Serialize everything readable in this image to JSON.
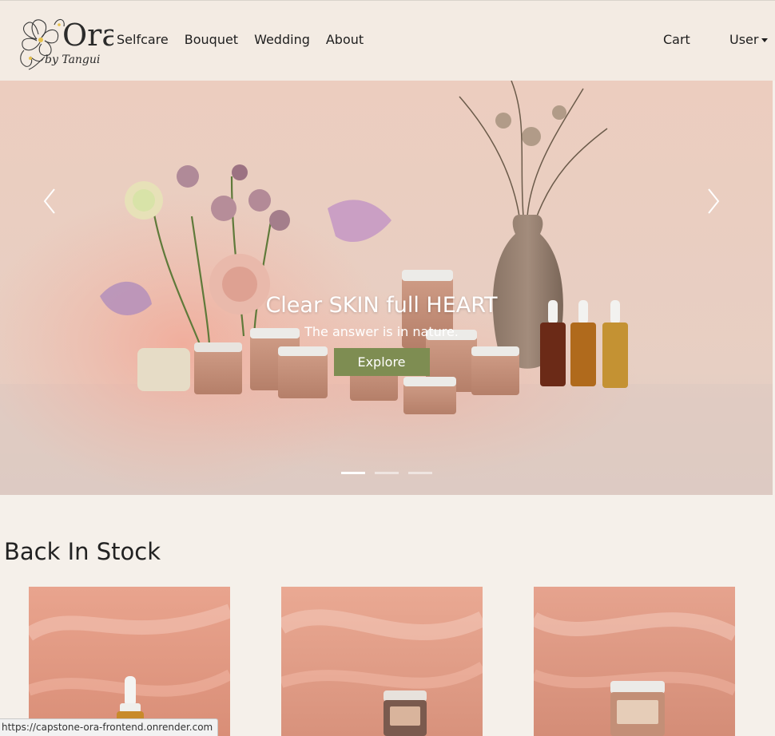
{
  "navbar": {
    "brand": {
      "name": "Ora",
      "tagline": "by Tangui"
    },
    "links": [
      "Selfcare",
      "Bouquet",
      "Wedding",
      "About"
    ],
    "cart_label": "Cart",
    "user_label": "User"
  },
  "hero": {
    "title": "Clear SKIN full HEART",
    "subtitle": "The answer is in nature.",
    "cta_label": "Explore",
    "slide_count": 3,
    "active_slide": 0
  },
  "back_in_stock": {
    "title": "Back In Stock",
    "products": [
      "product-1",
      "product-2",
      "product-3"
    ]
  },
  "status_bar": {
    "url": "https://capstone-ora-frontend.onrender.com"
  },
  "colors": {
    "nav_bg": "#f3ebe3",
    "page_bg": "#f5f0ea",
    "accent_button": "#7e8d52"
  }
}
